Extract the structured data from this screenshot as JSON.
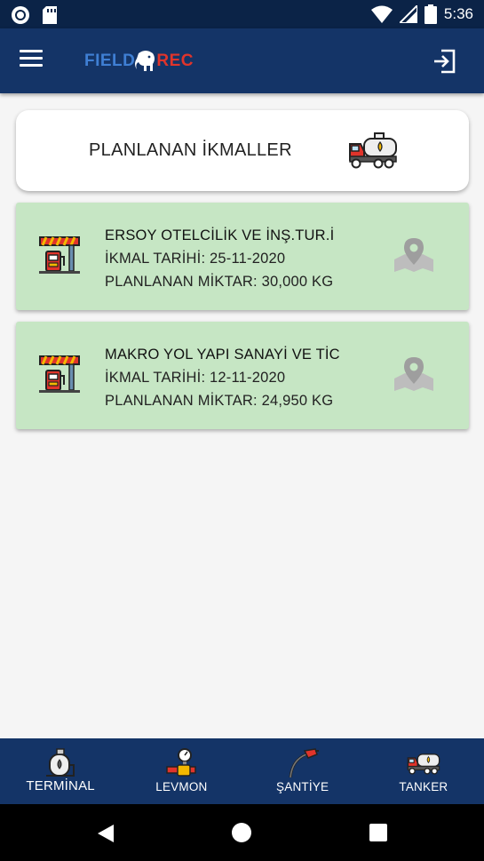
{
  "status_bar": {
    "time": "5:36"
  },
  "app_bar": {
    "logo_left": "FIELD",
    "logo_right": "REC",
    "menu_icon": "hamburger-menu-icon",
    "logout_icon": "logout-icon"
  },
  "header": {
    "title": "PLANLANAN İKMALLER",
    "icon": "fuel-tanker-truck-icon"
  },
  "cards": [
    {
      "name": "ERSOY OTELCİLİK VE İNŞ.TUR.İ",
      "date_line": "İKMAL TARİHİ:  25-11-2020",
      "amount_line": "PLANLANAN MİKTAR: 30,000 KG"
    },
    {
      "name": "MAKRO YOL YAPI SANAYİ VE TİC",
      "date_line": "İKMAL TARİHİ:  12-11-2020",
      "amount_line": "PLANLANAN MİKTAR: 24,950 KG"
    }
  ],
  "bottom_nav": [
    {
      "label": "TERMİNAL",
      "icon": "terminal-tank-icon"
    },
    {
      "label": "LEVMON",
      "icon": "pressure-valve-icon"
    },
    {
      "label": "ŞANTİYE",
      "icon": "fuel-nozzle-icon"
    },
    {
      "label": "TANKER",
      "icon": "tanker-truck-icon"
    }
  ],
  "colors": {
    "app_bar": "#143467",
    "status_bar": "#0b2347",
    "card_bg": "#c6e6c4",
    "logo_blue": "#3f7fd4",
    "logo_red": "#e0342b"
  }
}
